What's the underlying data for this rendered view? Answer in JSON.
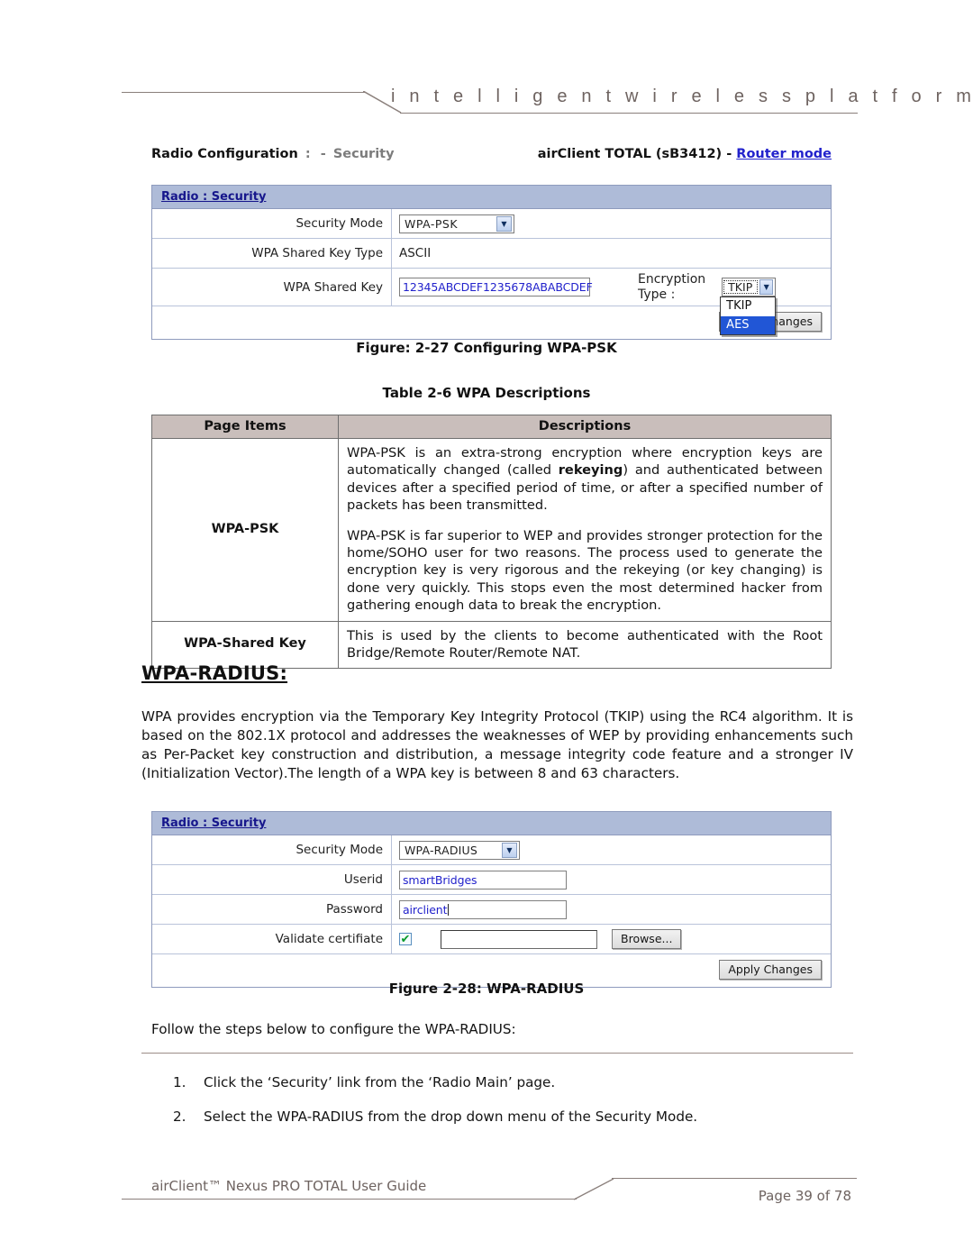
{
  "page": {
    "tagline": "i n t e l l i g e n t     w i r e l e s s     p l a t f o r m"
  },
  "screen1": {
    "breadcrumb_main": "Radio Configuration",
    "breadcrumb_colon": ":",
    "breadcrumb_dash": "-",
    "breadcrumb_sub": "Security",
    "device_label": "airClient TOTAL (sB3412) -",
    "device_mode_link": "Router mode",
    "panel_title": "Radio : Security",
    "rows": [
      {
        "label": "Security Mode",
        "value": "WPA-PSK",
        "type": "select"
      },
      {
        "label": "WPA Shared Key Type",
        "value": "ASCII",
        "type": "text"
      },
      {
        "label": "WPA Shared Key",
        "value": "12345ABCDEF1235678ABABCDEF",
        "type": "input"
      }
    ],
    "encryption_label_line1": "Encryption",
    "encryption_label_line2": "Type :",
    "encryption_value": "TKIP",
    "encryption_options": [
      "TKIP",
      "AES"
    ],
    "encryption_selected_option": "AES",
    "apply_button": "Apply Changes",
    "apply_button_visible_text": "anges"
  },
  "figure1_caption": "Figure: 2-27 Configuring WPA-PSK",
  "table": {
    "caption": "Table 2-6 WPA Descriptions",
    "headers": [
      "Page Items",
      "Descriptions"
    ],
    "rows": [
      {
        "item": "WPA-PSK",
        "paragraphs": [
          "WPA-PSK is an extra-strong encryption where encryption keys are automatically changed (called rekeying) and authenticated between devices after a specified period of time, or after a specified number of packets has been transmitted.",
          "WPA-PSK is far superior to WEP and provides stronger protection for the home/SOHO user for two reasons. The process used to generate the encryption key is very rigorous and the rekeying (or key changing) is done very quickly. This stops even the most determined hacker from gathering enough data to break the encryption."
        ],
        "bold_terms": [
          "rekeying"
        ]
      },
      {
        "item": "WPA-Shared Key",
        "paragraphs": [
          "This is used by the clients to become authenticated with the Root Bridge/Remote Router/Remote NAT."
        ],
        "bold_terms": []
      }
    ]
  },
  "section": {
    "title": "WPA-RADIUS:",
    "paragraph": "WPA provides encryption via the Temporary Key Integrity Protocol (TKIP) using the RC4 algorithm. It is based on the 802.1X protocol and addresses the weaknesses of WEP by providing enhancements such as Per-Packet key construction and distribution, a message integrity code feature and a stronger IV (Initialization Vector).The length of a WPA key is between 8 and 63 characters."
  },
  "screen2": {
    "panel_title": "Radio : Security",
    "rows": [
      {
        "label": "Security Mode",
        "value": "WPA-RADIUS",
        "type": "select"
      },
      {
        "label": "Userid",
        "value": "smartBridges",
        "type": "input"
      },
      {
        "label": "Password",
        "value": "airclient",
        "type": "input"
      },
      {
        "label": "Validate certifiate",
        "value": "",
        "type": "checkbox-file"
      }
    ],
    "checkbox_checked": true,
    "file_field_value": "",
    "browse_button": "Browse...",
    "apply_button": "Apply Changes"
  },
  "figure2_caption": "Figure 2-28: WPA-RADIUS",
  "instructions": {
    "intro": "Follow the steps below to configure the WPA-RADIUS:",
    "steps": [
      {
        "num": "1.",
        "text": "Click the ‘Security’ link from the ‘Radio Main’ page."
      },
      {
        "num": "2.",
        "text": "Select the WPA-RADIUS from the drop down menu of the Security Mode."
      }
    ]
  },
  "footer": {
    "left": "airClient™ Nexus PRO TOTAL User Guide",
    "right": "Page 39 of 78"
  }
}
